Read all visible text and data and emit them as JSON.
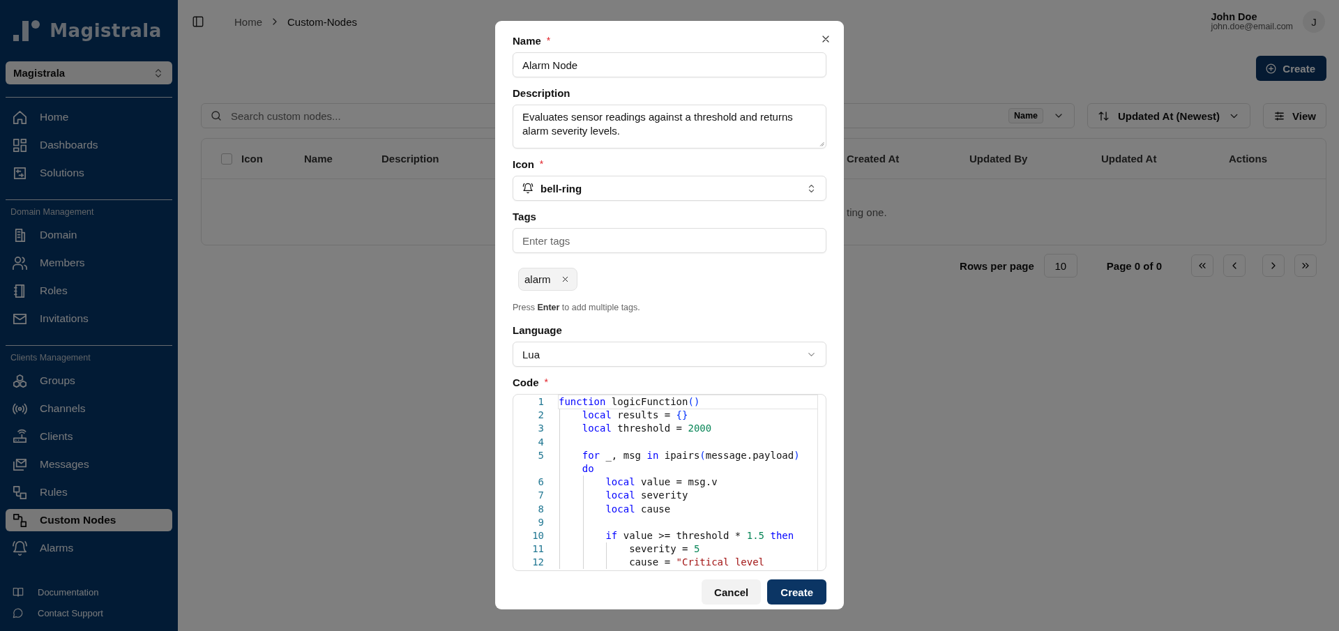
{
  "sidebar": {
    "brand": "Magistrala",
    "workspace": "Magistrala",
    "sections": [
      {
        "items": [
          {
            "label": "Home",
            "selected": false
          },
          {
            "label": "Dashboards",
            "selected": false
          },
          {
            "label": "Solutions",
            "selected": false
          }
        ]
      },
      {
        "heading": "Domain Management",
        "items": [
          {
            "label": "Domain",
            "selected": false
          },
          {
            "label": "Members",
            "selected": false
          },
          {
            "label": "Roles",
            "selected": false
          },
          {
            "label": "Invitations",
            "selected": false
          }
        ]
      },
      {
        "heading": "Clients Management",
        "items": [
          {
            "label": "Groups",
            "selected": false
          },
          {
            "label": "Channels",
            "selected": false
          },
          {
            "label": "Clients",
            "selected": false
          },
          {
            "label": "Messages",
            "selected": false
          },
          {
            "label": "Rules",
            "selected": false
          },
          {
            "label": "Custom Nodes",
            "selected": true
          },
          {
            "label": "Alarms",
            "selected": false
          }
        ]
      }
    ],
    "footer": [
      {
        "label": "Documentation"
      },
      {
        "label": "Contact Support"
      }
    ]
  },
  "header": {
    "breadcrumb": [
      "Home",
      "Custom-Nodes"
    ],
    "user": {
      "name": "John Doe",
      "email": "john.doe@email.com",
      "initial": "J"
    }
  },
  "page": {
    "create_button": "Create",
    "search": {
      "placeholder": "Search custom nodes..."
    },
    "filter_field": "Name",
    "sort_button": "Updated At (Newest)",
    "view_button": "View",
    "table": {
      "select_all_checked": false,
      "columns": [
        "Icon",
        "Name",
        "Description",
        "Created At",
        "Updated By",
        "Updated At",
        "Actions"
      ],
      "empty_message": "ting one."
    },
    "pagination": {
      "rows_label": "Rows per page",
      "rows_value": "10",
      "page_label": "Page 0 of 0"
    }
  },
  "dialog": {
    "fields": [
      {
        "kind": "text",
        "label": "Name",
        "required_mark": "*",
        "value": "Alarm Node"
      },
      {
        "kind": "textarea",
        "label": "Description",
        "value": "Evaluates sensor readings against a threshold and returns alarm severity levels."
      },
      {
        "kind": "select",
        "label": "Icon",
        "required_mark": "*",
        "value": "bell-ring"
      },
      {
        "kind": "tags",
        "label": "Tags",
        "placeholder": "Enter tags",
        "tags": [
          "alarm"
        ],
        "hint": "Press **Enter** to add multiple tags."
      },
      {
        "kind": "dropdown",
        "label": "Language",
        "value": "Lua"
      },
      {
        "kind": "code",
        "label": "Code",
        "required_mark": "*",
        "lines": [
          {
            "number": "1",
            "tokens": [
              {
                "kind": "keyword",
                "text": "function"
              },
              {
                "kind": "plain",
                "text": " logicFunction"
              },
              {
                "kind": "punct",
                "text": "()"
              }
            ],
            "children": [
              {
                "number": "2",
                "tokens": [
                  {
                    "kind": "keyword",
                    "text": "local"
                  },
                  {
                    "kind": "plain",
                    "text": " results = "
                  },
                  {
                    "kind": "punct",
                    "text": "{}"
                  }
                ]
              },
              {
                "number": "3",
                "tokens": [
                  {
                    "kind": "keyword",
                    "text": "local"
                  },
                  {
                    "kind": "plain",
                    "text": " threshold = "
                  },
                  {
                    "kind": "number",
                    "text": "2000"
                  }
                ]
              },
              {
                "number": "4"
              },
              {
                "number": "5",
                "tokens": [
                  {
                    "kind": "keyword",
                    "text": "for"
                  },
                  {
                    "kind": "plain",
                    "text": " _, msg "
                  },
                  {
                    "kind": "keyword",
                    "text": "in"
                  },
                  {
                    "kind": "plain",
                    "text": " ipairs"
                  },
                  {
                    "kind": "punct",
                    "text": "("
                  },
                  {
                    "kind": "plain",
                    "text": "message.payload"
                  },
                  {
                    "kind": "punct",
                    "text": ")"
                  }
                ],
                "wrap": [
                  {
                    "kind": "keyword",
                    "text": "do"
                  }
                ],
                "children": [
                  {
                    "number": "6",
                    "tokens": [
                      {
                        "kind": "keyword",
                        "text": "local"
                      },
                      {
                        "kind": "plain",
                        "text": " value = msg.v"
                      }
                    ]
                  },
                  {
                    "number": "7",
                    "tokens": [
                      {
                        "kind": "keyword",
                        "text": "local"
                      },
                      {
                        "kind": "plain",
                        "text": " severity"
                      }
                    ]
                  },
                  {
                    "number": "8",
                    "tokens": [
                      {
                        "kind": "keyword",
                        "text": "local"
                      },
                      {
                        "kind": "plain",
                        "text": " cause"
                      }
                    ]
                  },
                  {
                    "number": "9"
                  },
                  {
                    "number": "10",
                    "tokens": [
                      {
                        "kind": "keyword",
                        "text": "if"
                      },
                      {
                        "kind": "plain",
                        "text": " value >= threshold * "
                      },
                      {
                        "kind": "number",
                        "text": "1.5"
                      },
                      {
                        "kind": "keyword",
                        "text": " then"
                      }
                    ],
                    "children": [
                      {
                        "number": "11",
                        "tokens": [
                          {
                            "kind": "plain",
                            "text": "severity = "
                          },
                          {
                            "kind": "number",
                            "text": "5"
                          }
                        ]
                      },
                      {
                        "number": "12",
                        "tokens": [
                          {
                            "kind": "plain",
                            "text": "cause = "
                          },
                          {
                            "kind": "string",
                            "text": "\"Critical level"
                          }
                        ]
                      }
                    ]
                  }
                ]
              }
            ]
          }
        ]
      }
    ],
    "buttons": [
      {
        "kind": "secondary",
        "label": "Cancel"
      },
      {
        "kind": "primary",
        "label": "Create"
      }
    ]
  }
}
